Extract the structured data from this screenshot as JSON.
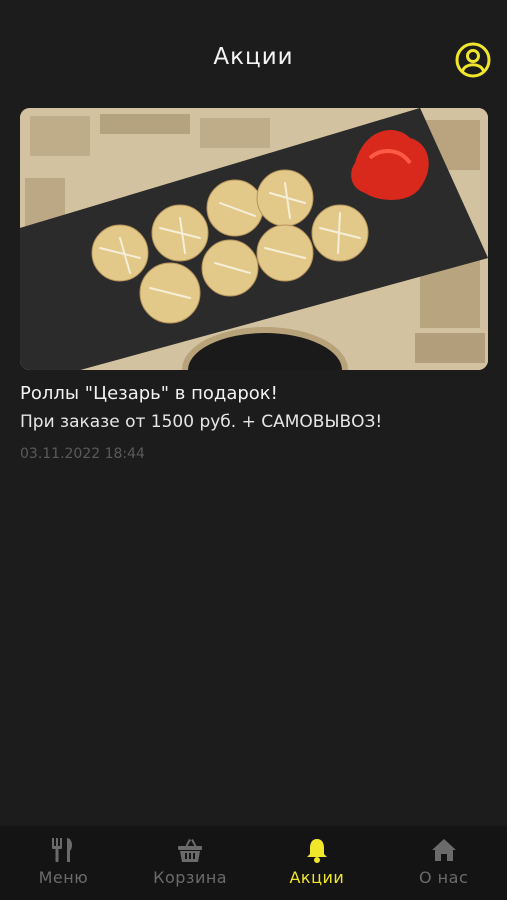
{
  "header": {
    "title": "Акции"
  },
  "promo": {
    "title": "Роллы \"Цезарь\" в подарок!",
    "description": "При заказе от 1500 руб. + САМОВЫВОЗ!",
    "date": "03.11.2022 18:44"
  },
  "tabbar": {
    "items": [
      {
        "label": "Меню",
        "icon": "fork-knife-icon",
        "active": false
      },
      {
        "label": "Корзина",
        "icon": "basket-icon",
        "active": false
      },
      {
        "label": "Акции",
        "icon": "bell-icon",
        "active": true
      },
      {
        "label": "О нас",
        "icon": "home-icon",
        "active": false
      }
    ]
  },
  "colors": {
    "background": "#1c1c1c",
    "accent": "#f0e62a",
    "inactive": "#6b6b6b",
    "tabbar_bg": "#141414"
  }
}
